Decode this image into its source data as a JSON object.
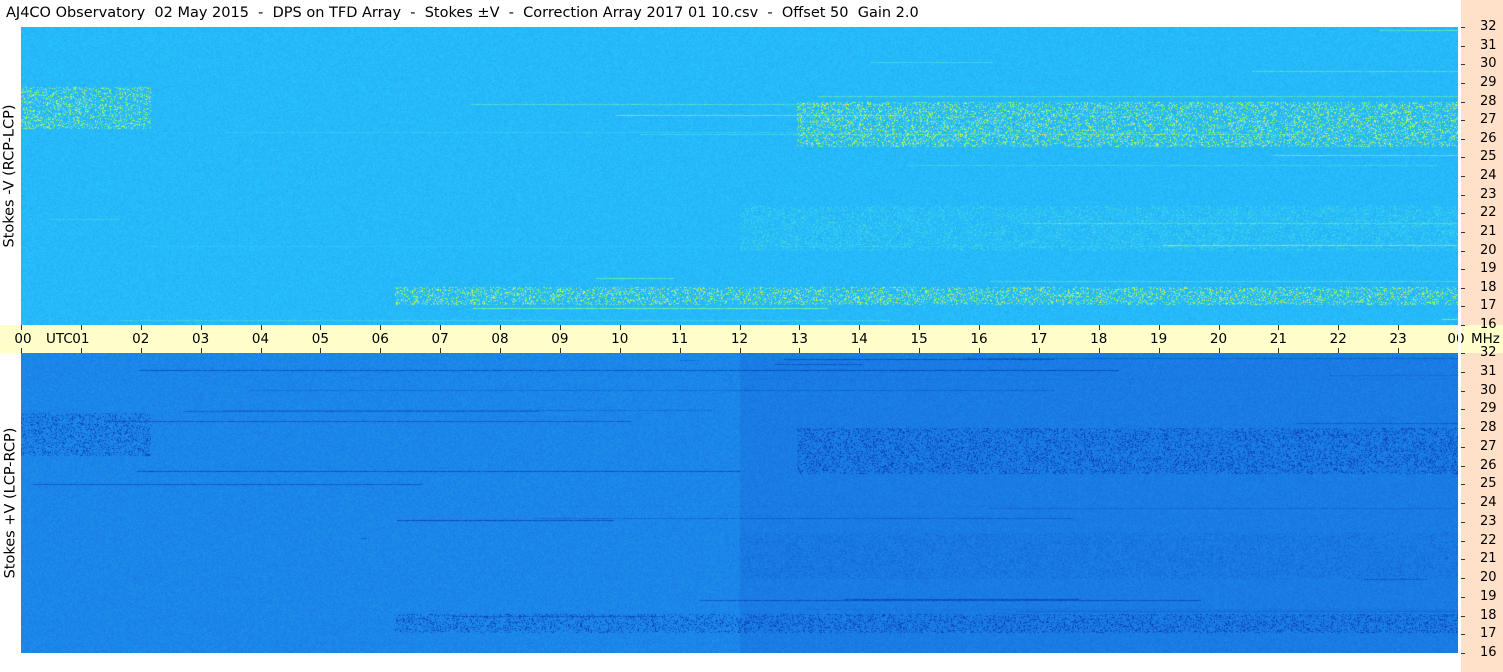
{
  "title": "AJ4CO Observatory  02 May 2015  -  DPS on TFD Array  -  Stokes ±V  -  Correction Array 2017 01 10.csv  -  Offset 50  Gain 2.0",
  "chart_data": [
    {
      "type": "heatmap",
      "panel": "top",
      "ylabel": "Stokes -V (RCP-LCP)",
      "x_unit": "UTC",
      "x_ticks": [
        "00",
        "01",
        "02",
        "03",
        "04",
        "05",
        "06",
        "07",
        "08",
        "09",
        "10",
        "11",
        "12",
        "13",
        "14",
        "15",
        "16",
        "17",
        "18",
        "19",
        "20",
        "21",
        "22",
        "23",
        "00"
      ],
      "y_unit": "MHz",
      "y_ticks": [
        32,
        31,
        30,
        29,
        28,
        27,
        26,
        25,
        24,
        23,
        22,
        21,
        20,
        19,
        18,
        17,
        16
      ],
      "xlim": [
        0,
        24
      ],
      "ylim": [
        16,
        32
      ],
      "colormap": [
        "#0b3fb8",
        "#1a7fe6",
        "#29c8ff",
        "#9cff6a",
        "#ffe632",
        "#ff3a3a"
      ],
      "background_level": 0.36
    },
    {
      "type": "heatmap",
      "panel": "bottom",
      "ylabel": "Stokes +V (LCP-RCP)",
      "x_unit": "UTC",
      "x_ticks": [
        "00",
        "01",
        "02",
        "03",
        "04",
        "05",
        "06",
        "07",
        "08",
        "09",
        "10",
        "11",
        "12",
        "13",
        "14",
        "15",
        "16",
        "17",
        "18",
        "19",
        "20",
        "21",
        "22",
        "23",
        "00"
      ],
      "y_unit": "MHz",
      "y_ticks": [
        32,
        31,
        30,
        29,
        28,
        27,
        26,
        25,
        24,
        23,
        22,
        21,
        20,
        19,
        18,
        17,
        16
      ],
      "xlim": [
        0,
        24
      ],
      "ylim": [
        16,
        32
      ],
      "colormap": [
        "#0b3fb8",
        "#1a7fe6",
        "#29c8ff",
        "#9cff6a",
        "#ffe632",
        "#ff3a3a"
      ],
      "background_level": 0.22
    }
  ]
}
